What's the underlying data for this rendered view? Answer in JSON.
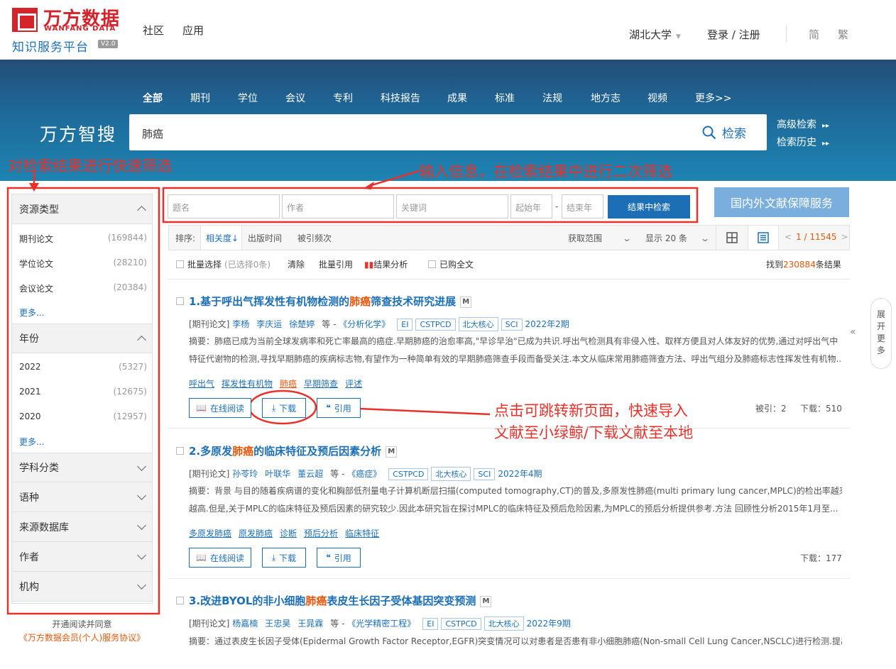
{
  "header": {
    "logo_cn": "万方数据",
    "logo_en": "WANFANG DATA",
    "logo_sub": "知识服务平台",
    "version": "V2.0",
    "nav": [
      "社区",
      "应用"
    ],
    "institution": "湖北大学",
    "login": "登录 / 注册",
    "lang_simple": "简",
    "lang_trad": "繁"
  },
  "tabs": [
    "全部",
    "期刊",
    "学位",
    "会议",
    "专利",
    "科技报告",
    "成果",
    "标准",
    "法规",
    "地方志",
    "视频",
    "更多>>"
  ],
  "search": {
    "brand": "万方智搜",
    "query": "肺癌",
    "button": "检索",
    "advanced": "高级检索",
    "history": "检索历史"
  },
  "annotations": {
    "left": "对检索结果进行快速筛选",
    "top": "输入信息，在检索结果中进行二次筛选",
    "right1": "点击可跳转新页面，快速导入",
    "right2": "文献至小绿鲸/下载文献至本地"
  },
  "sidebar": {
    "resource_title": "资源类型",
    "resource_items": [
      {
        "label": "期刊论文",
        "count": "(169844)"
      },
      {
        "label": "学位论文",
        "count": "(28210)"
      },
      {
        "label": "会议论文",
        "count": "(20384)"
      }
    ],
    "more": "更多...",
    "year_title": "年份",
    "year_items": [
      {
        "label": "2022",
        "count": "(5327)"
      },
      {
        "label": "2021",
        "count": "(12675)"
      },
      {
        "label": "2020",
        "count": "(12957)"
      }
    ],
    "collapsed": [
      "学科分类",
      "语种",
      "来源数据库",
      "作者",
      "机构"
    ],
    "footer1": "开通阅读并同意",
    "footer2": "《万方数据会员(个人)服务协议》"
  },
  "filter": {
    "title": "题名",
    "author": "作者",
    "keyword": "关键词",
    "start": "起始年",
    "dash": "-",
    "end": "结束年",
    "button": "结果中检索",
    "service": "国内外文献保障服务"
  },
  "sort": {
    "label": "排序:",
    "relevance": "相关度",
    "date": "出版时间",
    "cited": "被引频次",
    "scope": "获取范围",
    "show": "显示 20 条",
    "page": "1 / 11545"
  },
  "toolbar": {
    "batch": "批量选择",
    "selected": "(已选择0条)",
    "clear": "清除",
    "cite": "批量引用",
    "analysis": "结果分析",
    "bought": "已购全文",
    "found_pre": "找到",
    "found_num": "230884",
    "found_post": "条结果"
  },
  "results": [
    {
      "t1": "1.基于呼出气挥发性有机物检测的",
      "t2": "肺癌",
      "t3": "筛查技术研究进展",
      "type": "[期刊论文]",
      "authors": [
        "李杨",
        "李庆运",
        "徐楚婷"
      ],
      "etc": "等",
      "journal": "《分析化学》",
      "tags": [
        "EI",
        "CSTPCD",
        "北大核心",
        "SCI"
      ],
      "issue": "2022年2期",
      "abs1": "摘要：肺癌已成为当前全球发病率和死亡率最高的癌症.早期肺癌的治愈率高,\"早诊早治\"已成为共识.呼出气检测具有非侵入性、取样方便且对人体友好的优势,通过对呼出气中",
      "abs2": "特征代谢物的检测,寻找早期肺癌的疾病标志物,有望作为一种简单有效的早期肺癌筛查手段而备受关注.本文从临床常用肺癌筛查方法、呼出气组分及肺癌标志性挥发性有机物...",
      "keywords": [
        "呼出气",
        "挥发性有机物",
        "肺癌",
        "早期筛查",
        "评述"
      ],
      "cited": "被引：2",
      "downloads": "下载：510"
    },
    {
      "t1": "2.多原发",
      "t2": "肺癌",
      "t3": "的临床特征及预后因素分析",
      "type": "[期刊论文]",
      "authors": [
        "孙苓玲",
        "叶联华",
        "董云超"
      ],
      "etc": "等",
      "journal": "《癌症》",
      "tags": [
        "CSTPCD",
        "北大核心",
        "SCI"
      ],
      "issue": "2022年4期",
      "abs1": "摘要：背景 与目的随着疾病谱的变化和胸部低剂量电子计算机断层扫描(computed tomography,CT)的普及,多原发性肺癌(multi primary lung cancer,MPLC)的检出率越来",
      "abs2": "越高.但是,关于MPLC的临床特征及预后因素的研究较少.因此本研究旨在探讨MPLC的临床特征及预后危险因素,为MPLC的预后分析提供参考.方法 回顾性分析2015年1月至...",
      "keywords": [
        "多原发肺癌",
        "原发肺癌",
        "诊断",
        "预后分析",
        "临床特征"
      ],
      "downloads": "下载：177"
    },
    {
      "t1": "3.改进BYOL的非小细胞",
      "t2": "肺癌",
      "t3": "表皮生长因子受体基因突变预测",
      "type": "[期刊论文]",
      "authors": [
        "杨嘉楠",
        "王忠昊",
        "王晁霖"
      ],
      "etc": "等",
      "journal": "《光学精密工程》",
      "tags": [
        "EI",
        "CSTPCD",
        "北大核心"
      ],
      "issue": "2022年9期",
      "abs1": "摘要：通过表皮生长因子受体(Epidermal Growth Factor Receptor,EGFR)突变情况可以对患者是否患有非小细胞肺癌(Non-small Cell Lung Cancer,NSCLC)进行检测.提出"
    }
  ],
  "actions": {
    "read": "在线阅读",
    "download": "下载",
    "cite": "引用"
  },
  "expand": "展开更多",
  "colors": {
    "brand": "#d4232b",
    "link": "#1d6fb5",
    "highlight": "#e8570b",
    "annotation": "#e8312b"
  }
}
